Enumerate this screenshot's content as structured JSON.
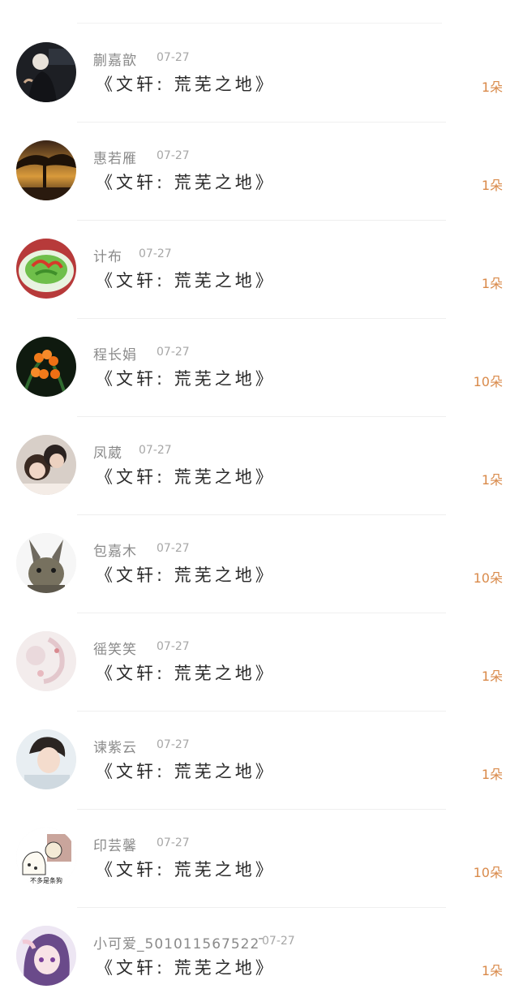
{
  "items": [
    {
      "username": "蒯嘉歆",
      "time": "07-27",
      "title": "《文轩: 荒芜之地》",
      "count": "1朵",
      "avatar": "night-portrait-icon"
    },
    {
      "username": "惠若雁",
      "time": "07-27",
      "title": "《文轩: 荒芜之地》",
      "count": "1朵",
      "avatar": "tree-sunset-icon"
    },
    {
      "username": "计布",
      "time": "07-27",
      "title": "《文轩: 荒芜之地》",
      "count": "1朵",
      "avatar": "food-plate-icon"
    },
    {
      "username": "程长娟",
      "time": "07-27",
      "title": "《文轩: 荒芜之地》",
      "count": "10朵",
      "avatar": "orange-flowers-icon"
    },
    {
      "username": "凤葳",
      "time": "07-27",
      "title": "《文轩: 荒芜之地》",
      "count": "1朵",
      "avatar": "couple-photo-icon"
    },
    {
      "username": "包嘉木",
      "time": "07-27",
      "title": "《文轩: 荒芜之地》",
      "count": "10朵",
      "avatar": "rabbit-head-icon"
    },
    {
      "username": "徭笑笑",
      "time": "07-27",
      "title": "《文轩: 荒芜之地》",
      "count": "1朵",
      "avatar": "pale-illustration-icon"
    },
    {
      "username": "谏紫云",
      "time": "07-27",
      "title": "《文轩: 荒芜之地》",
      "count": "1朵",
      "avatar": "boy-portrait-icon"
    },
    {
      "username": "印芸馨",
      "time": "07-27",
      "title": "《文轩: 荒芜之地》",
      "count": "10朵",
      "avatar": "meme-sticker-icon"
    },
    {
      "username": "小可爱_5010115675​22 ̄",
      "time": "07-27",
      "title": "《文轩: 荒芜之地》",
      "count": "1朵",
      "avatar": "anime-girl-icon"
    }
  ],
  "meme_text": "不多是条狗"
}
